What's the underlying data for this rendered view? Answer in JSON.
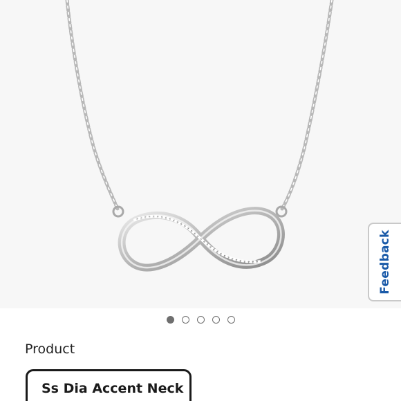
{
  "gallery": {
    "image_icon": "infinity-necklace-image",
    "dots": [
      {
        "active": true
      },
      {
        "active": false
      },
      {
        "active": false
      },
      {
        "active": false
      },
      {
        "active": false
      }
    ]
  },
  "feedback": {
    "label": "Feedback",
    "color": "#1a5aa8"
  },
  "product": {
    "section_label": "Product",
    "selected_option": "Ss Dia Accent Neck"
  },
  "colors": {
    "image_background": "#f7f7f7",
    "dot": "#6f6f6f",
    "select_border": "#1a1a1a"
  }
}
